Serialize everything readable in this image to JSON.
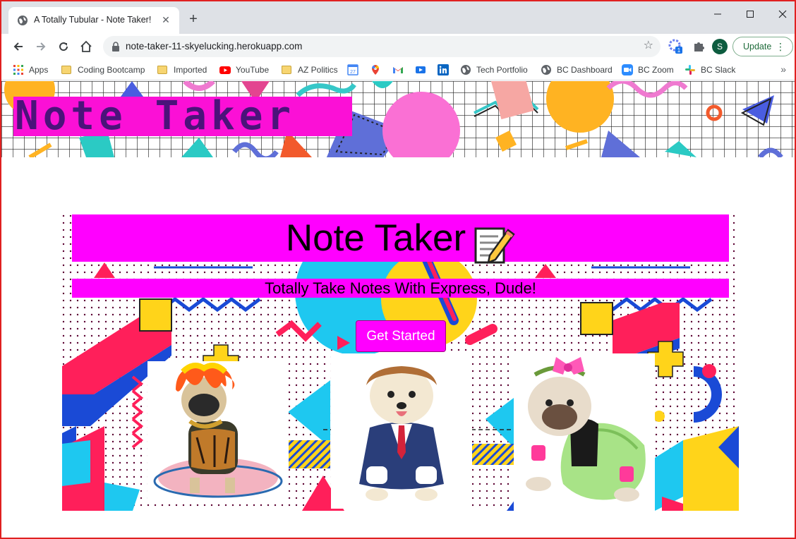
{
  "browser": {
    "tab_title": "A Totally Tubular - Note Taker!",
    "url": "note-taker-11-skyelucking.herokuapp.com",
    "update_label": "Update",
    "profile_initial": "S"
  },
  "bookmarks": [
    {
      "label": "Apps",
      "icon": "apps-grid-icon"
    },
    {
      "label": "Coding Bootcamp",
      "icon": "folder-icon"
    },
    {
      "label": "Imported",
      "icon": "folder-icon"
    },
    {
      "label": "YouTube",
      "icon": "youtube-icon"
    },
    {
      "label": "AZ Politics",
      "icon": "folder-icon"
    },
    {
      "label": "",
      "icon": "calendar-icon",
      "icon_text": "27"
    },
    {
      "label": "",
      "icon": "maps-icon"
    },
    {
      "label": "",
      "icon": "gmail-icon"
    },
    {
      "label": "",
      "icon": "video-icon"
    },
    {
      "label": "",
      "icon": "linkedin-icon"
    },
    {
      "label": "Tech Portfolio",
      "icon": "globe-icon"
    },
    {
      "label": "BC Dashboard",
      "icon": "globe-icon"
    },
    {
      "label": "BC Zoom",
      "icon": "zoom-icon"
    },
    {
      "label": "BC Slack",
      "icon": "slack-icon"
    }
  ],
  "header": {
    "brand": "Note Taker"
  },
  "hero": {
    "title": "Note Taker",
    "subtitle": "Totally Take Notes With Express, Dude!",
    "cta_label": "Get Started"
  },
  "colors": {
    "accent": "#ff00ff",
    "brand_bar": "#fb10d6",
    "brand_text": "#4b137a"
  }
}
